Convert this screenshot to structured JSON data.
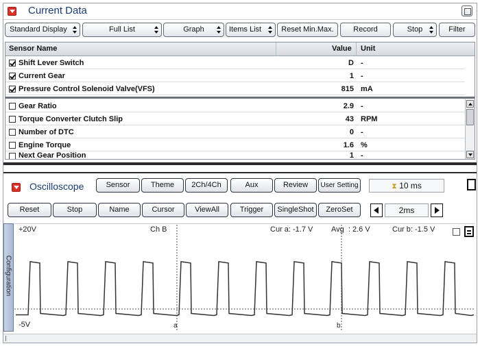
{
  "current_data": {
    "title": "Current Data",
    "toolbar": {
      "standard_display": "Standard Display",
      "full_list": "Full List",
      "graph": "Graph",
      "items_list": "Items List",
      "reset_minmax": "Reset Min.Max.",
      "record": "Record",
      "stop": "Stop",
      "filter": "Filter"
    },
    "columns": {
      "name": "Sensor Name",
      "value": "Value",
      "unit": "Unit"
    },
    "rows": [
      {
        "name": "Shift Lever Switch",
        "value": "D",
        "unit": "-",
        "checked": true
      },
      {
        "name": "Current Gear",
        "value": "1",
        "unit": "-",
        "checked": true
      },
      {
        "name": "Pressure Control Solenoid Valve(VFS)",
        "value": "815",
        "unit": "mA",
        "checked": true
      },
      {
        "name": "Gear Ratio",
        "value": "2.9",
        "unit": "-",
        "checked": false
      },
      {
        "name": "Torque Converter Clutch Slip",
        "value": "43",
        "unit": "RPM",
        "checked": false
      },
      {
        "name": "Number of DTC",
        "value": "0",
        "unit": "-",
        "checked": false
      },
      {
        "name": "Engine Torque",
        "value": "1.6",
        "unit": "%",
        "checked": false
      },
      {
        "name": "Next Gear Position",
        "value": "1",
        "unit": "-",
        "checked": false
      }
    ]
  },
  "oscilloscope": {
    "title": "Oscilloscope",
    "row1": {
      "sensor": "Sensor",
      "theme": "Theme",
      "channels": "2Ch/4Ch",
      "aux": "Aux",
      "review": "Review",
      "user_setting": "User Setting",
      "time_display": "10 ms"
    },
    "row2": {
      "reset": "Reset",
      "stop": "Stop",
      "name": "Name",
      "cursor": "Cursor",
      "viewall": "ViewAll",
      "trigger": "Trigger",
      "singleshot": "SingleShot",
      "zeroset": "ZeroSet",
      "timebase": "2ms"
    },
    "config_tab": "Configuration",
    "scope_labels": {
      "top_voltage": "+20V",
      "bottom_voltage": "-5V",
      "channel": "Ch B",
      "cur_a": "Cur a: -1.7 V",
      "avg": "Avg  : 2.6 V",
      "cur_b": "Cur b: -1.5 V",
      "cursor_a": "a",
      "cursor_b": "b"
    },
    "waveform": {
      "y_range": [
        -5,
        20
      ],
      "high_level": 11.8,
      "low_level": -1.7,
      "pulses": 12
    }
  },
  "colors": {
    "accent_red": "#d9322b",
    "title_blue": "#1a3b73",
    "trace": "#333333"
  }
}
